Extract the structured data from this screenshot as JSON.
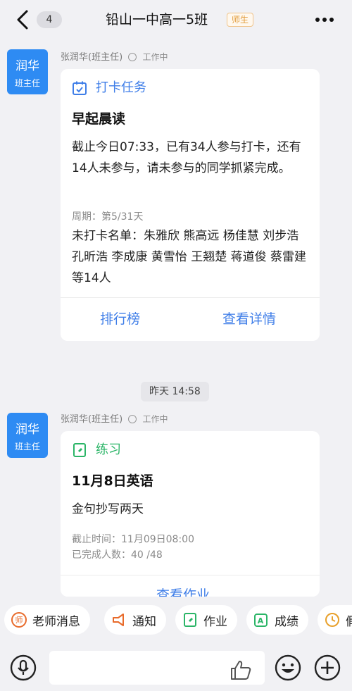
{
  "header": {
    "back_count": "4",
    "title": "铅山一中高一5班",
    "badge": "师生"
  },
  "messages": [
    {
      "avatar_name": "润华",
      "avatar_role": "班主任",
      "sender": "张润华(班主任)",
      "status": "工作中",
      "card_type": "打卡任务",
      "card_title": "早起晨读",
      "body": "截止今日07:33，已有34人参与打卡，还有14人未参与，请未参与的同学抓紧完成。",
      "cycle": "周期：第5/31天",
      "names": "未打卡名单：朱雅欣  熊高远  杨佳慧  刘步浩  孔昕浩  李成康  黄雪怡  王翘楚  蒋道俊  蔡雷建等14人",
      "action_left": "排行榜",
      "action_right": "查看详情"
    },
    {
      "avatar_name": "润华",
      "avatar_role": "班主任",
      "sender": "张润华(班主任)",
      "status": "工作中",
      "card_type": "练习",
      "card_title": "11月8日英语",
      "body": "金句抄写两天",
      "deadline": "截止时间：11月09日08:00",
      "completed": "已完成人数：40 /48",
      "action": "查看作业"
    }
  ],
  "timestamp": "昨天 14:58",
  "quickbar": [
    {
      "label": "老师消息",
      "icon": "teacher-icon"
    },
    {
      "label": "通知",
      "icon": "megaphone-icon"
    },
    {
      "label": "作业",
      "icon": "homework-icon"
    },
    {
      "label": "成绩",
      "icon": "grades-icon"
    },
    {
      "label": "假",
      "icon": "clock-icon"
    }
  ],
  "colors": {
    "accent_blue": "#3f7ee8",
    "avatar_blue": "#2e8bf3",
    "practice_green": "#2bb567",
    "badge_orange": "#e29b3a"
  }
}
